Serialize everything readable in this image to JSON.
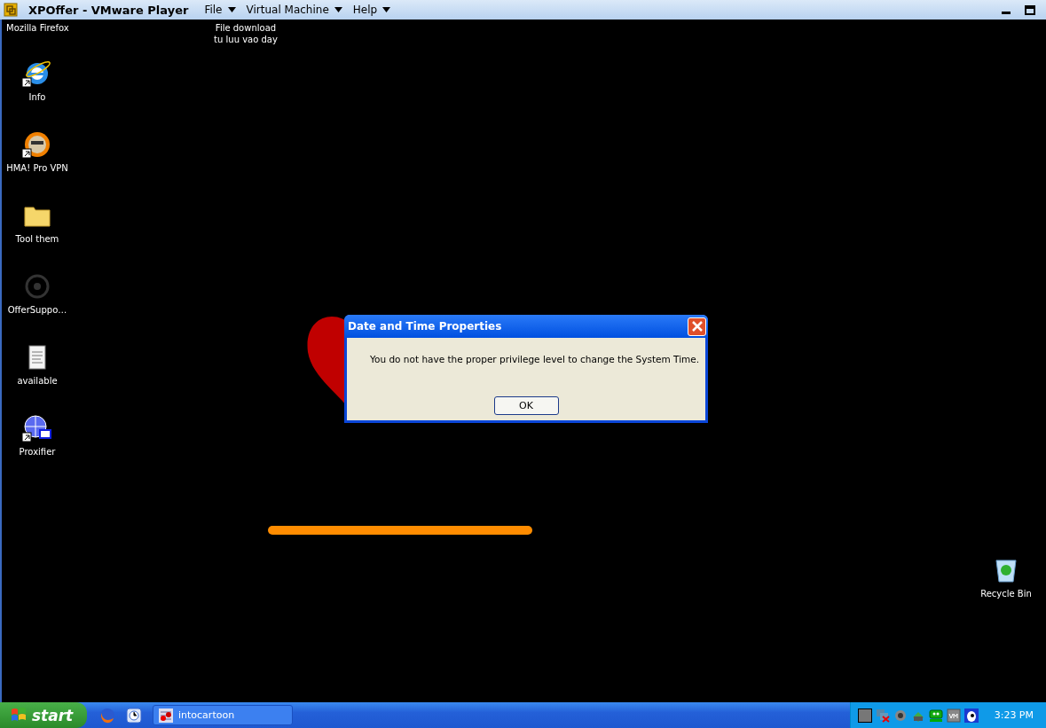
{
  "window": {
    "title": "XPOffer - VMware Player",
    "menus": [
      {
        "label": "File"
      },
      {
        "label": "Virtual Machine"
      },
      {
        "label": "Help"
      }
    ]
  },
  "desktop": {
    "top_labels": [
      {
        "lines": [
          "Mozilla Firefox"
        ]
      },
      {
        "lines": [
          "File download",
          "tu luu vao day"
        ]
      }
    ],
    "icons": [
      {
        "label": "Info",
        "kind": "browser",
        "shortcut": true
      },
      {
        "label": "HMA! Pro VPN",
        "kind": "vpn",
        "shortcut": true
      },
      {
        "label": "Tool them",
        "kind": "folder",
        "shortcut": false
      },
      {
        "label": "OfferSuppo…",
        "kind": "biohazard",
        "shortcut": false
      },
      {
        "label": "available",
        "kind": "notepad",
        "shortcut": false
      },
      {
        "label": "Proxifier",
        "kind": "globe",
        "shortcut": true
      }
    ],
    "recycle_bin": {
      "label": "Recycle Bin"
    }
  },
  "dialog": {
    "title": "Date and Time Properties",
    "message": "You do not have the proper privilege level to change the System Time.",
    "button": "OK"
  },
  "taskbar": {
    "start": "start",
    "quick_launch": [
      {
        "kind": "firefox"
      },
      {
        "kind": "clock"
      }
    ],
    "tasks": [
      {
        "label": "intocartoon",
        "selected": false
      }
    ],
    "tray": [
      {
        "kind": "square"
      },
      {
        "kind": "network"
      },
      {
        "kind": "speaker"
      },
      {
        "kind": "recycle"
      },
      {
        "kind": "green"
      },
      {
        "kind": "vm"
      },
      {
        "kind": "penguin"
      }
    ],
    "clock": "3:23 PM"
  }
}
